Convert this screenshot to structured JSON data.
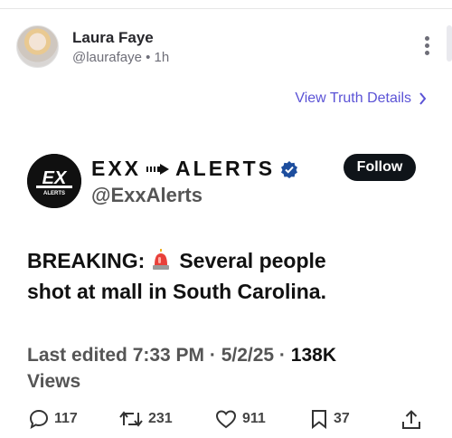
{
  "post": {
    "author_name": "Laura Faye",
    "author_handle": "@laurafaye",
    "separator": "•",
    "time_ago": "1h"
  },
  "truth_link": {
    "label": "View Truth Details"
  },
  "embed": {
    "display_name_left": "EXX",
    "display_name_right": "ALERTS",
    "handle": "@ExxAlerts",
    "follow_label": "Follow",
    "logo_text": "ALERTS",
    "breaking_label": "BREAKING:",
    "text_line1": "Several people",
    "text_line2": "shot at mall in South Carolina.",
    "meta_prefix": "Last edited 7:33 PM · 5/2/25 ·",
    "views_count": "138K",
    "views_label": "Views"
  },
  "actions": {
    "replies": "117",
    "reposts": "231",
    "likes": "911",
    "bookmarks": "37"
  },
  "icons": [
    "more-vertical-icon",
    "chevron-right-icon",
    "verified-badge-icon",
    "siren-emoji-icon",
    "reply-icon",
    "repost-icon",
    "like-icon",
    "bookmark-icon",
    "share-icon"
  ],
  "colors": {
    "link": "#5b53d6",
    "verified": "#1d4e9e",
    "follow_bg": "#0f1419"
  }
}
